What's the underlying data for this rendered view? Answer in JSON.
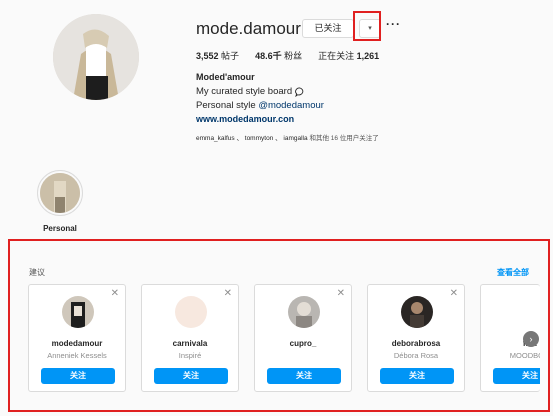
{
  "profile": {
    "username": "mode.damour",
    "following_button": "已关注",
    "dropdown_icon": "▾",
    "more_icon": "···",
    "stats": {
      "posts_count": "3,552",
      "posts_label": "帖子",
      "followers_count": "48.6千",
      "followers_label": "粉丝",
      "following_label": "正在关注",
      "following_count": "1,261"
    },
    "full_name": "Moded'amour",
    "bio_line1": "My curated style board",
    "bio_line2_prefix": "Personal style",
    "bio_mention": "@modedamour",
    "website": "www.modedamour.con",
    "followed_by": {
      "names": "emma_kalfus 、 tommyton 、 iamgalla",
      "suffix": "和其他 16 位用户关注了"
    }
  },
  "highlight": {
    "label": "Personal"
  },
  "suggestions": {
    "title": "建议",
    "see_all": "查看全部",
    "cards": [
      {
        "username": "modedamour",
        "subtitle": "Anneniek Kessels",
        "button": "关注"
      },
      {
        "username": "carnivala",
        "subtitle": "Inspiré",
        "button": "关注"
      },
      {
        "username": "cupro_",
        "subtitle": "",
        "button": "关注"
      },
      {
        "username": "deborabrosa",
        "subtitle": "Débora Rosa",
        "button": "关注"
      },
      {
        "username": "fh...",
        "subtitle": "MOODBO...",
        "button": "关注"
      }
    ]
  },
  "colors": {
    "accent_blue": "#0095f6",
    "annotation_red": "#e02020",
    "link_blue": "#00376b"
  }
}
